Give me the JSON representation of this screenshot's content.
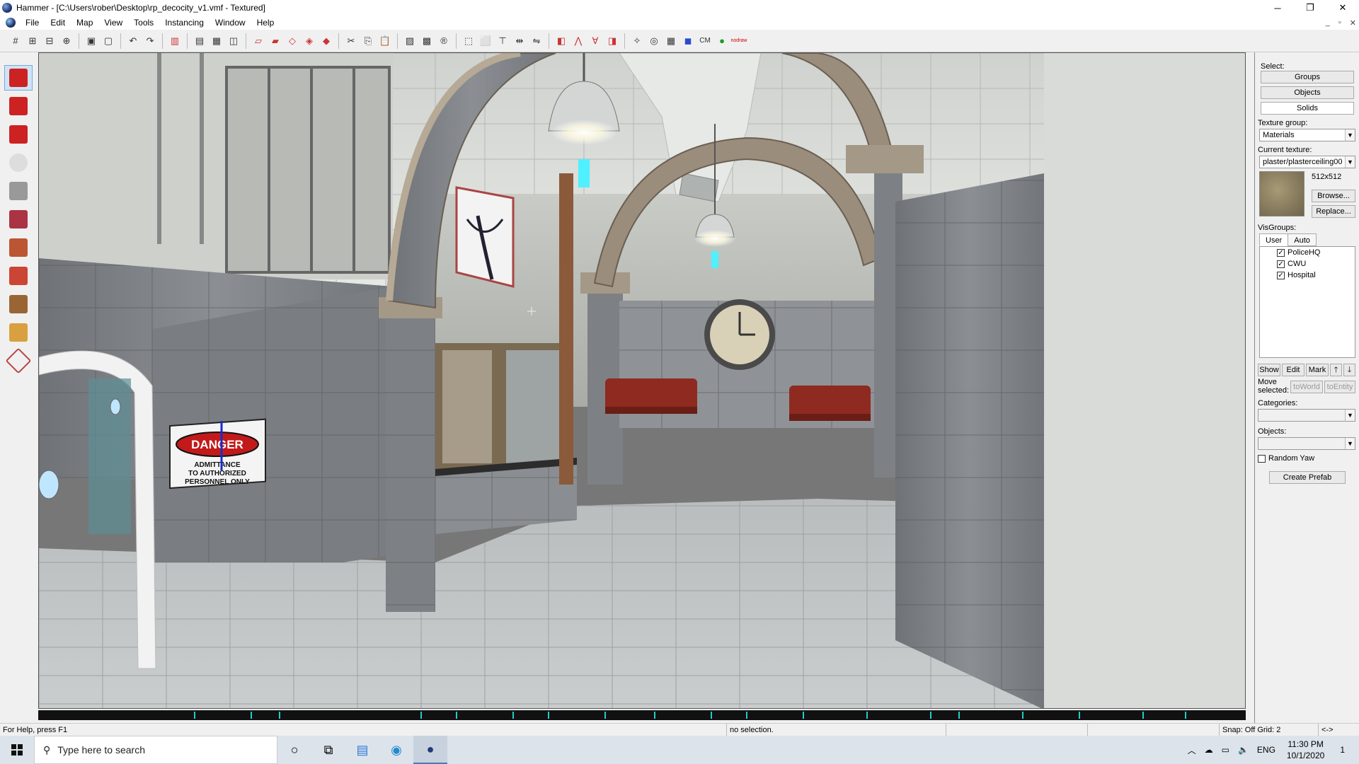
{
  "window": {
    "title": "Hammer - [C:\\Users\\rober\\Desktop\\rp_decocity_v1.vmf - Textured]",
    "minimize": "─",
    "maximize": "❐",
    "close": "✕"
  },
  "menu": [
    "File",
    "Edit",
    "Map",
    "View",
    "Tools",
    "Instancing",
    "Window",
    "Help"
  ],
  "mdi": {
    "minimize": "_",
    "restore": "▫",
    "close": "✕"
  },
  "toolbar": [
    "grid-icon",
    "grid-plus-icon",
    "grid-minus-icon",
    "grid-add-icon",
    "sep",
    "group-icon",
    "ungroup-icon",
    "sep",
    "undo-icon",
    "redo-icon",
    "sep",
    "carve-icon",
    "sep",
    "hollow-icon",
    "clip-icon",
    "ignore-icon",
    "sep",
    "brush-1-icon",
    "brush-2-icon",
    "brush-3-icon",
    "brush-4-icon",
    "brush-5-icon",
    "sep",
    "cut-icon",
    "copy-icon",
    "paste-icon",
    "sep",
    "hazard-icon",
    "hazard-x-icon",
    "circle-r-icon",
    "sep",
    "select-icon",
    "select-2-icon",
    "texture-lock-icon",
    "align-icon",
    "flip-icon",
    "sep",
    "entity-icon",
    "path-icon",
    "valve-icon",
    "face-icon",
    "sep",
    "vertex-icon",
    "sphere-icon",
    "grid-3d-icon",
    "cube-icon",
    "cm-label",
    "leaf-icon",
    "nodraw-icon"
  ],
  "toolbar_text": {
    "cm": "CM",
    "nodraw": "nodraw"
  },
  "tools": [
    {
      "name": "selection-tool",
      "active": true
    },
    {
      "name": "magnify-tool",
      "active": false
    },
    {
      "name": "camera-tool",
      "active": false
    },
    {
      "name": "entity-tool",
      "active": false
    },
    {
      "name": "block-tool",
      "active": false
    },
    {
      "name": "texture-tool",
      "active": false
    },
    {
      "name": "apply-texture-tool",
      "active": false
    },
    {
      "name": "decal-tool",
      "active": false
    },
    {
      "name": "overlay-tool",
      "active": false
    },
    {
      "name": "clip-tool",
      "active": false
    },
    {
      "name": "vertex-tool",
      "active": false
    }
  ],
  "viewport": {
    "sign_top": "DANGER",
    "sign_line1": "ADMITTANCE",
    "sign_line2": "TO AUTHORIZED",
    "sign_line3": "PERSONNEL ONLY"
  },
  "right_panel": {
    "select_label": "Select:",
    "groups": "Groups",
    "objects": "Objects",
    "solids": "Solids",
    "texture_group_label": "Texture group:",
    "texture_group_value": "Materials",
    "current_texture_label": "Current texture:",
    "current_texture_value": "plaster/plasterceiling00",
    "texture_size": "512x512",
    "browse": "Browse...",
    "replace": "Replace...",
    "visgroups_label": "VisGroups:",
    "tab_user": "User",
    "tab_auto": "Auto",
    "visgroups": [
      "PoliceHQ",
      "CWU",
      "Hospital"
    ],
    "show": "Show",
    "edit": "Edit",
    "mark": "Mark",
    "up": "🡑",
    "down": "🡓",
    "move_selected": "Move selected:",
    "to_world": "toWorld",
    "to_entity": "toEntity",
    "categories_label": "Categories:",
    "objects_label": "Objects:",
    "random_yaw": "Random Yaw",
    "create_prefab": "Create Prefab"
  },
  "status": {
    "help": "For Help, press F1",
    "selection": "no selection.",
    "snap": "Snap: Off Grid: 2",
    "arrows": "<->"
  },
  "taskbar": {
    "search_placeholder": "Type here to search",
    "lang": "ENG",
    "time": "11:30 PM",
    "date": "10/1/2020",
    "notifications": "1"
  },
  "colors": {
    "ceiling": "#d9dcd8",
    "wall": "#b8bbb6",
    "stone": "#7e8286",
    "floor": "#bfc3c3",
    "arch": "#9a8d7c",
    "bench": "#8e2a20",
    "lamp": "#4ff0ff"
  }
}
